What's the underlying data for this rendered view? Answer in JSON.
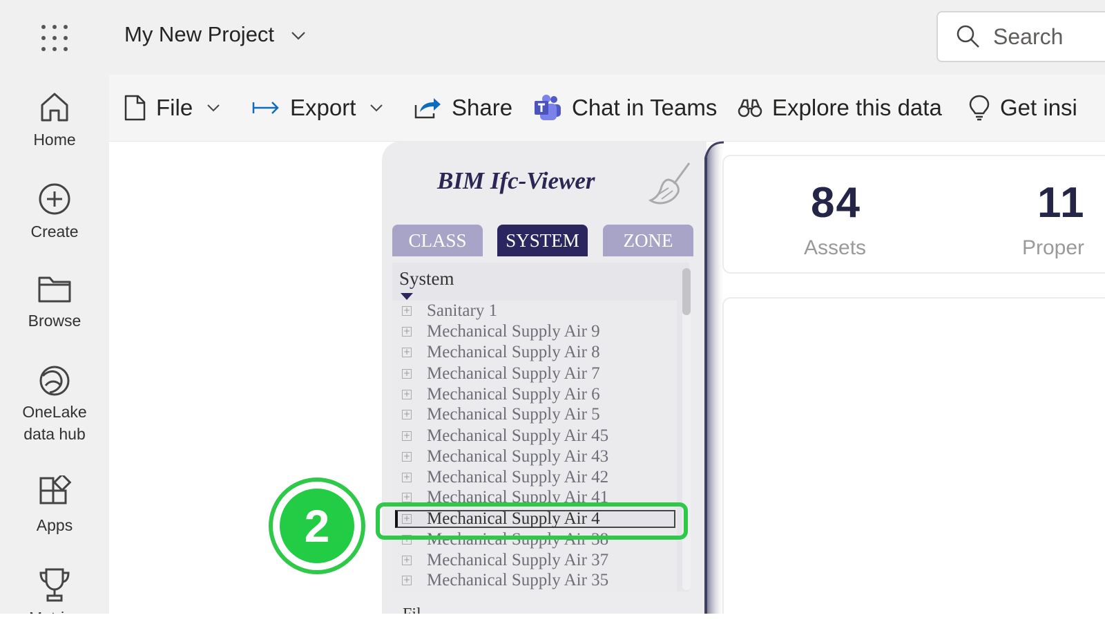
{
  "topbar": {
    "project_name": "My New Project",
    "search_placeholder": "Search"
  },
  "nav": {
    "items": [
      {
        "label": "Home",
        "icon": "home-icon"
      },
      {
        "label": "Create",
        "icon": "plus-circle-icon"
      },
      {
        "label": "Browse",
        "icon": "folder-icon"
      },
      {
        "label": "OneLake data hub",
        "icon": "onelake-icon"
      },
      {
        "label": "Apps",
        "icon": "apps-icon"
      },
      {
        "label": "Metrics",
        "icon": "trophy-icon"
      }
    ]
  },
  "toolbar": {
    "file": "File",
    "export": "Export",
    "share": "Share",
    "chat": "Chat in Teams",
    "explore": "Explore this data",
    "insights": "Get insi"
  },
  "viewer": {
    "title": "BIM Ifc-Viewer",
    "tabs": [
      {
        "label": "CLASS",
        "active": false
      },
      {
        "label": "SYSTEM",
        "active": true
      },
      {
        "label": "ZONE",
        "active": false
      }
    ],
    "list_header": "System",
    "rows": [
      "Sanitary 1",
      "Mechanical Supply Air 9",
      "Mechanical Supply Air 8",
      "Mechanical Supply Air 7",
      "Mechanical Supply Air 6",
      "Mechanical Supply Air 5",
      "Mechanical Supply Air 45",
      "Mechanical Supply Air 43",
      "Mechanical Supply Air 42",
      "Mechanical Supply Air 41",
      "Mechanical Supply Air 4",
      "Mechanical Supply Air 38",
      "Mechanical Supply Air 37",
      "Mechanical Supply Air 35"
    ],
    "selected_row": "Mechanical Supply Air 4",
    "bottom_label": "Fil"
  },
  "kpis": [
    {
      "value": "84",
      "label": "Assets"
    },
    {
      "value": "11",
      "label": "Proper"
    }
  ],
  "annotation": {
    "step": "2",
    "color": "#2fc94a"
  }
}
